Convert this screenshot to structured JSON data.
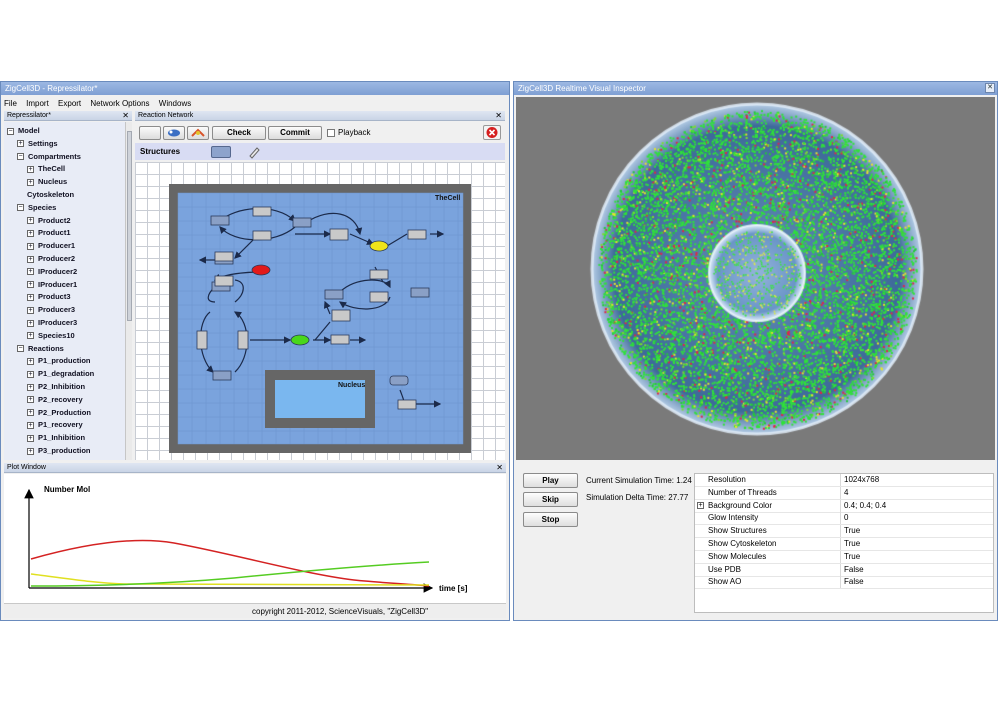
{
  "left_window": {
    "title": "ZigCell3D - Repressilator*",
    "menu": [
      "File",
      "Import",
      "Export",
      "Network Options",
      "Windows"
    ]
  },
  "tree_panel": {
    "title": "Repressilator*",
    "rows": [
      {
        "label": "Model",
        "indent": 0,
        "expander": "minus"
      },
      {
        "label": "Settings",
        "indent": 1,
        "expander": "plus"
      },
      {
        "label": "Compartments",
        "indent": 1,
        "expander": "minus"
      },
      {
        "label": "TheCell",
        "indent": 2,
        "expander": "plus"
      },
      {
        "label": "Nucleus",
        "indent": 2,
        "expander": "plus"
      },
      {
        "label": "Cytoskeleton",
        "indent": 2,
        "expander": "none"
      },
      {
        "label": "Species",
        "indent": 1,
        "expander": "minus"
      },
      {
        "label": "Product2",
        "indent": 2,
        "expander": "plus"
      },
      {
        "label": "Product1",
        "indent": 2,
        "expander": "plus"
      },
      {
        "label": "Producer1",
        "indent": 2,
        "expander": "plus"
      },
      {
        "label": "Producer2",
        "indent": 2,
        "expander": "plus"
      },
      {
        "label": "IProducer2",
        "indent": 2,
        "expander": "plus"
      },
      {
        "label": "IProducer1",
        "indent": 2,
        "expander": "plus"
      },
      {
        "label": "Product3",
        "indent": 2,
        "expander": "plus"
      },
      {
        "label": "Producer3",
        "indent": 2,
        "expander": "plus"
      },
      {
        "label": "IProducer3",
        "indent": 2,
        "expander": "plus"
      },
      {
        "label": "Species10",
        "indent": 2,
        "expander": "plus"
      },
      {
        "label": "Reactions",
        "indent": 1,
        "expander": "minus"
      },
      {
        "label": "P1_production",
        "indent": 2,
        "expander": "plus"
      },
      {
        "label": "P1_degradation",
        "indent": 2,
        "expander": "plus"
      },
      {
        "label": "P2_Inhibition",
        "indent": 2,
        "expander": "plus"
      },
      {
        "label": "P2_recovery",
        "indent": 2,
        "expander": "plus"
      },
      {
        "label": "P2_Production",
        "indent": 2,
        "expander": "plus"
      },
      {
        "label": "P1_recovery",
        "indent": 2,
        "expander": "plus"
      },
      {
        "label": "P1_Inhibition",
        "indent": 2,
        "expander": "plus"
      },
      {
        "label": "P3_production",
        "indent": 2,
        "expander": "plus"
      }
    ]
  },
  "network_panel": {
    "title": "Reaction Network",
    "check_label": "Check",
    "commit_label": "Commit",
    "playback_label": "Playback",
    "structures_label": "Structures",
    "cell_label": "TheCell",
    "nucleus_label": "Nucleus"
  },
  "plot_panel": {
    "title": "Plot Window",
    "ylabel": "Number Mol",
    "xlabel": "time [s]"
  },
  "footer": {
    "copyright": "copyright 2011-2012, ScienceVisuals, \"ZigCell3D\""
  },
  "right_window": {
    "title": "ZigCell3D Realtime Visual Inspector",
    "play_label": "Play",
    "skip_label": "Skip",
    "stop_label": "Stop",
    "current_time": "Current Simulation Time: 1.24",
    "delta_time": "Simulation Delta Time: 27.77",
    "properties": [
      {
        "key": "Resolution",
        "value": "1024x768",
        "expander": false
      },
      {
        "key": "Number of Threads",
        "value": "4",
        "expander": false
      },
      {
        "key": "Background Color",
        "value": "0.4; 0.4; 0.4",
        "expander": true
      },
      {
        "key": "Glow Intensity",
        "value": "0",
        "expander": false
      },
      {
        "key": "Show Structures",
        "value": "True",
        "expander": false
      },
      {
        "key": "Show Cytoskeleton",
        "value": "True",
        "expander": false
      },
      {
        "key": "Show Molecules",
        "value": "True",
        "expander": false
      },
      {
        "key": "Use PDB",
        "value": "False",
        "expander": false
      },
      {
        "key": "Show AO",
        "value": "False",
        "expander": false
      }
    ]
  },
  "colors": {
    "titlebar": "#8aa8d8",
    "cell_fill": "#7aa3dd",
    "cell_wall": "#666666",
    "curve_red": "#d42222",
    "curve_green": "#55cc22",
    "curve_yellow": "#e0e020",
    "molecule_green": "#2fe23a",
    "molecule_red": "#e0244a"
  },
  "icons": [
    "close-icon",
    "arrow-select-icon",
    "add-species-icon",
    "add-reaction-icon",
    "delete-icon",
    "pencil-icon",
    "compartment-shape-icon"
  ]
}
